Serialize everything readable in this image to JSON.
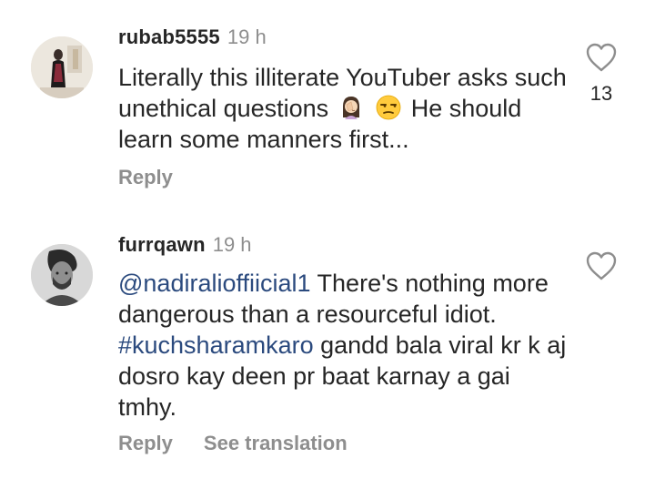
{
  "comments": [
    {
      "username": "rubab5555",
      "time": "19 h",
      "text_part1": "Literally this illiterate YouTuber asks such unethical questions",
      "emoji_1": "woman-facepalming-emoji",
      "emoji_2": "unamused-face-emoji",
      "text_part2": "He should learn some manners first...",
      "likes": "13",
      "reply_label": "Reply"
    },
    {
      "username": "furrqawn",
      "time": "19 h",
      "mention": "@nadiralioffiicial1",
      "text_part1": "There's nothing more dangerous than a resourceful idiot.",
      "hashtag": "#kuchsharamkaro",
      "text_part2": "gandd bala viral kr k aj dosro kay deen pr baat karnay a gai tmhy.",
      "reply_label": "Reply",
      "translation_label": "See translation"
    }
  ],
  "colors": {
    "text": "#262626",
    "muted": "#8e8e8e",
    "link": "#2b4a7e"
  }
}
